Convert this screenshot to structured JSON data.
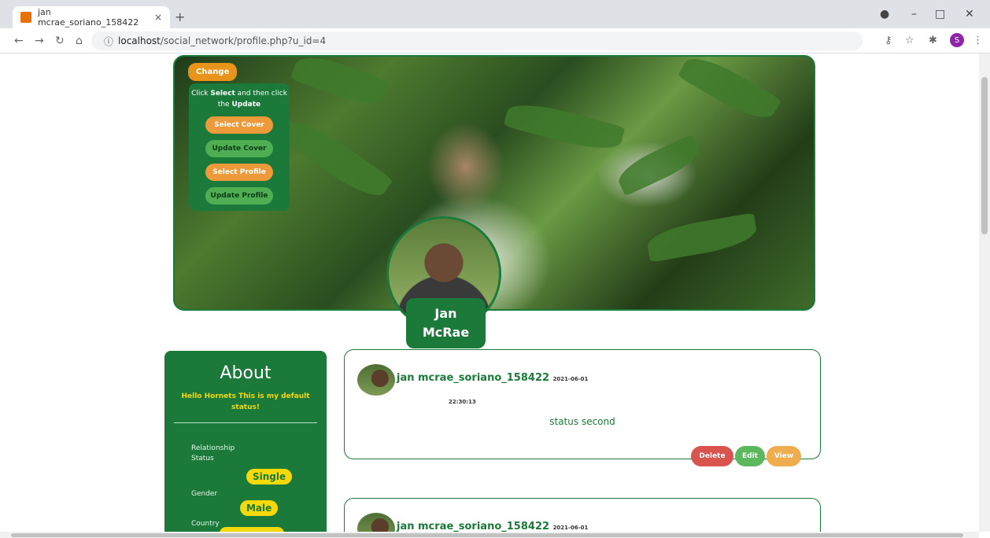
{
  "browser": {
    "tab_title": "jan mcrae_soriano_158422",
    "tab_close": "×",
    "new_tab": "+",
    "url_host": "localhost",
    "url_path": "/social_network/profile.php?u_id=4",
    "profile_initial": "S"
  },
  "cover": {
    "change_label": "Change",
    "instruction_prefix": "Click ",
    "instruction_select": "Select",
    "instruction_mid": " and then click the ",
    "instruction_update": "Update",
    "select_cover": "Select Cover",
    "update_cover": "Update Cover",
    "select_profile": "Select Profile",
    "update_profile": "Update Profile"
  },
  "profile": {
    "first_name": "Jan",
    "last_name": "McRae"
  },
  "about": {
    "title": "About",
    "status": "Hello Hornets This is my default status!",
    "relationship_label": "Relationship Status",
    "relationship_value": "Single",
    "gender_label": "Gender",
    "gender_value": "Male",
    "country_label": "Country"
  },
  "posts": [
    {
      "author": "jan mcrae_soriano_158422",
      "date": "2021-06-01",
      "time": "22:30:13",
      "body": "status second",
      "delete_label": "Delete",
      "edit_label": "Edit",
      "view_label": "View"
    },
    {
      "author": "jan mcrae_soriano_158422",
      "date": "2021-06-01"
    }
  ],
  "colors": {
    "brand_green": "#1b7a3a",
    "accent_orange": "#ef9a3a",
    "accent_yellow": "#f5d90a",
    "delete_red": "#d9534f",
    "edit_green": "#5cb85c",
    "view_orange": "#f0ad4e"
  }
}
